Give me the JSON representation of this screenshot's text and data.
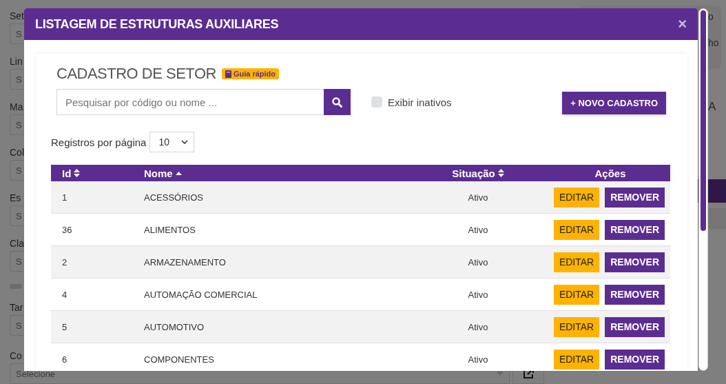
{
  "background": {
    "fields": [
      {
        "label": "Set",
        "placeholder": "S"
      },
      {
        "label": "Lin",
        "placeholder": "S"
      },
      {
        "label": "Ma",
        "placeholder": "S"
      },
      {
        "label": "Col",
        "placeholder": "S"
      },
      {
        "label": "Es",
        "placeholder": "S"
      },
      {
        "label": "Cla",
        "placeholder": "S"
      }
    ],
    "checkbox": {
      "checked": false
    },
    "fields_after_checkbox": [
      {
        "label": "Tar",
        "placeholder": "S"
      },
      {
        "label": "Co",
        "placeholder": "Selecione",
        "kind": "select-link"
      }
    ],
    "side_texts": [
      "o",
      "ho",
      "A"
    ]
  },
  "modal": {
    "title": "LISTAGEM DE ESTRUTURAS AUXILIARES",
    "close": "×",
    "heading": "CADASTRO DE SETOR",
    "badge": "Guia rápido",
    "search": {
      "placeholder": "Pesquisar por código ou nome ..."
    },
    "show_inactive": {
      "label": "Exibir inativos",
      "checked": false
    },
    "new_button": "+ NOVO CADASTRO",
    "per_page": {
      "label": "Registros por página",
      "value": "10"
    },
    "table": {
      "columns": [
        {
          "label": "Id",
          "sorted": false
        },
        {
          "label": "Nome",
          "sorted": true
        },
        {
          "label": "Situação",
          "sorted": false
        },
        {
          "label": "Ações"
        }
      ],
      "rows": [
        {
          "id": "1",
          "name": "ACESSÓRIOS",
          "status": "Ativo",
          "actions": [
            {
              "label": "EDITAR",
              "kind": "edit"
            },
            {
              "label": "REMOVER",
              "kind": "remove"
            }
          ]
        },
        {
          "id": "36",
          "name": "ALIMENTOS",
          "status": "Ativo",
          "actions": [
            {
              "label": "EDITAR",
              "kind": "edit"
            },
            {
              "label": "REMOVER",
              "kind": "remove"
            }
          ]
        },
        {
          "id": "2",
          "name": "ARMAZENAMENTO",
          "status": "Ativo",
          "actions": [
            {
              "label": "EDITAR",
              "kind": "edit"
            },
            {
              "label": "REMOVER",
              "kind": "remove"
            }
          ]
        },
        {
          "id": "4",
          "name": "AUTOMAÇÃO COMERCIAL",
          "status": "Ativo",
          "actions": [
            {
              "label": "EDITAR",
              "kind": "edit"
            },
            {
              "label": "REMOVER",
              "kind": "remove"
            }
          ]
        },
        {
          "id": "5",
          "name": "AUTOMOTIVO",
          "status": "Ativo",
          "actions": [
            {
              "label": "EDITAR",
              "kind": "edit"
            },
            {
              "label": "REMOVER",
              "kind": "remove"
            }
          ]
        },
        {
          "id": "6",
          "name": "COMPONENTES",
          "status": "Ativo",
          "actions": [
            {
              "label": "EDITAR",
              "kind": "edit"
            },
            {
              "label": "REMOVER",
              "kind": "remove"
            }
          ]
        }
      ]
    }
  }
}
